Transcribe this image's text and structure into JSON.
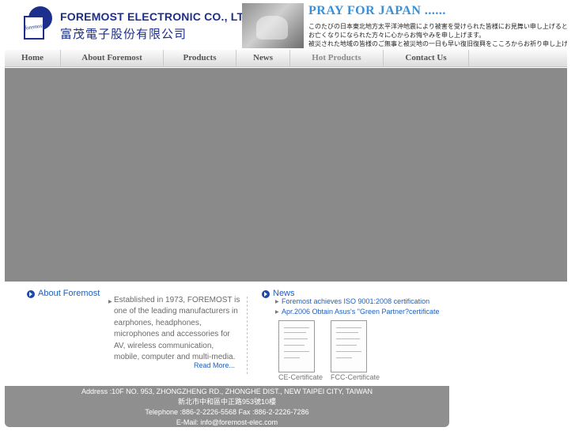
{
  "header": {
    "logo_text": "foremost",
    "company_name_en": "FOREMOST ELECTRONIC CO., LTD.",
    "company_name_zh": "富茂電子股份有限公司"
  },
  "banner": {
    "title": "PRAY FOR JAPAN ......",
    "lines": [
      "このたびの日本東北地方太平洋沖地震により被害を受けられた皆様にお見舞い申し上げると共に、",
      "お亡くなりになられた方々に心からお悔やみを申し上げます。",
      "被災された地域の皆様のご無事と被災地の一日も早い復旧復興をこころからお祈り申し上げます。"
    ]
  },
  "nav": {
    "items": [
      {
        "label": "Home"
      },
      {
        "label": "About Foremost"
      },
      {
        "label": "Products"
      },
      {
        "label": "News"
      },
      {
        "label": "Hot Products"
      },
      {
        "label": "Contact Us"
      }
    ]
  },
  "about": {
    "heading": "About Foremost",
    "text": "Established in 1973, FOREMOST is one of the leading manufacturers in earphones, headphones, microphones and accessories for AV, wireless communication, mobile, computer and multi-media.",
    "read_more": "Read More..."
  },
  "news": {
    "heading": "News",
    "items": [
      {
        "text": "Foremost achieves ISO 9001:2008 certification"
      },
      {
        "text": "Apr.2006 Obtain Asus's \"Green Partner?certificate"
      }
    ],
    "certificates": [
      {
        "label": "CE-Certificate"
      },
      {
        "label": "FCC-Certificate"
      }
    ]
  },
  "footer": {
    "address_en": "Address :10F NO. 953, ZHONGZHENG RD., ZHONGHE DIST., NEW TAIPEI CITY, TAIWAN",
    "address_zh": "新北市中和區中正路953號10樓",
    "phone": "Telephone :886-2-2226-5568 Fax :886-2-2226-7286",
    "email": "E-Mail: info@foremost-elec.com"
  },
  "colors": {
    "brand_blue": "#1d2f8c",
    "link_blue": "#1f5fc0",
    "hero_gray": "#8a8a8a",
    "footer_gray": "#8f8f8f"
  }
}
